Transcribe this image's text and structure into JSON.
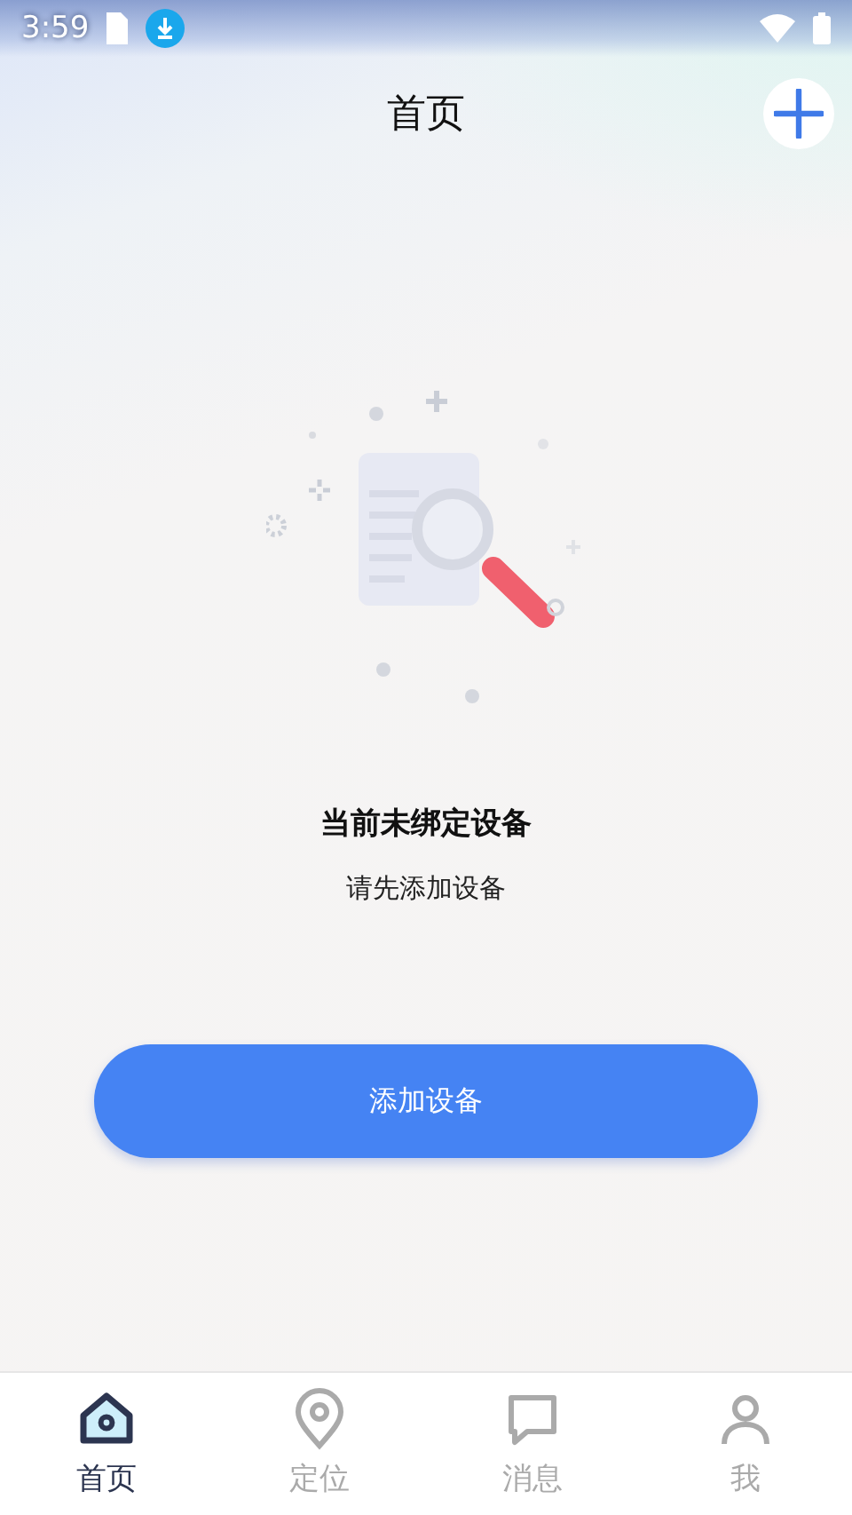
{
  "status_bar": {
    "time": "3:59"
  },
  "header": {
    "title": "首页"
  },
  "empty_state": {
    "title": "当前未绑定设备",
    "subtitle": "请先添加设备"
  },
  "primary_button": {
    "label": "添加设备"
  },
  "tab_bar": [
    {
      "label": "首页",
      "kind": "home",
      "selected": true
    },
    {
      "label": "定位",
      "kind": "location",
      "selected": false
    },
    {
      "label": "消息",
      "kind": "message",
      "selected": false
    },
    {
      "label": "我",
      "kind": "profile",
      "selected": false
    }
  ]
}
